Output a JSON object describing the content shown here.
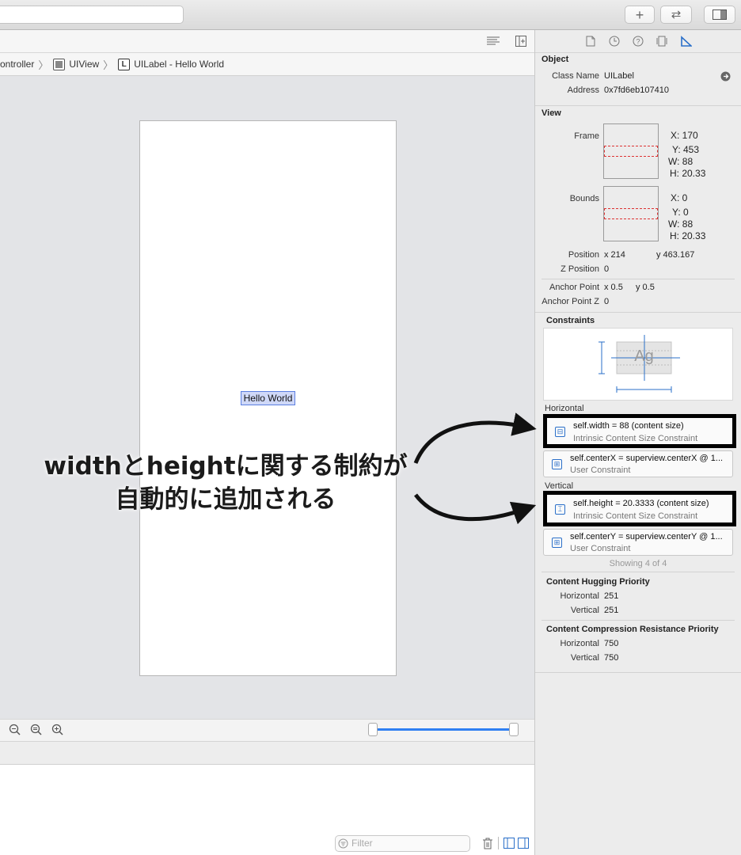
{
  "toolbar": {
    "add_icon": "plus-icon",
    "add_label": "+",
    "swap_icon": "swap-arrows-icon",
    "swap_label": "⇄",
    "panel_icon": "right-panel-toggle-icon"
  },
  "breadcrumb": {
    "items": [
      "ontroller",
      "UIView",
      "UILabel - Hello World"
    ],
    "label_glyph": "L"
  },
  "canvas": {
    "label_text": "Hello World"
  },
  "zoom": {
    "zoom_out_icon": "zoom-out-icon",
    "zoom_fit_icon": "zoom-fit-icon",
    "zoom_in_icon": "zoom-in-icon"
  },
  "console": {
    "filter_placeholder": "Filter"
  },
  "inspector": {
    "tabs": [
      "file-icon",
      "history-icon",
      "help-icon",
      "size-icon",
      "layout-icon"
    ],
    "object": {
      "title": "Object",
      "class_name_label": "Class Name",
      "class_name": "UILabel",
      "address_label": "Address",
      "address": "0x7fd6eb107410"
    },
    "view": {
      "title": "View",
      "frame_label": "Frame",
      "frame": {
        "x": "X: 170",
        "y": "Y: 453",
        "w": "W: 88",
        "h": "H: 20.33"
      },
      "bounds_label": "Bounds",
      "bounds": {
        "x": "X: 0",
        "y": "Y: 0",
        "w": "W: 88",
        "h": "H: 20.33"
      },
      "position_label": "Position",
      "position_x": "x 214",
      "position_y": "y 463.167",
      "zposition_label": "Z Position",
      "zposition": "0",
      "anchor_label": "Anchor Point",
      "anchor_x": "x 0.5",
      "anchor_y": "y 0.5",
      "anchor_z_label": "Anchor Point Z",
      "anchor_z": "0"
    },
    "constraints": {
      "title": "Constraints",
      "figure_text": "Ag",
      "horizontal_label": "Horizontal",
      "vertical_label": "Vertical",
      "horizontal": [
        {
          "text": "self.width = 88 (content size)",
          "kind": "Intrinsic Content Size Constraint"
        },
        {
          "text": "self.centerX = superview.centerX @ 1...",
          "kind": "User Constraint"
        }
      ],
      "vertical": [
        {
          "text": "self.height = 20.3333 (content size)",
          "kind": "Intrinsic Content Size Constraint"
        },
        {
          "text": "self.centerY = superview.centerY @ 1...",
          "kind": "User Constraint"
        }
      ],
      "showing": "Showing 4 of 4"
    },
    "hugging": {
      "title": "Content Hugging Priority",
      "horizontal_label": "Horizontal",
      "horizontal": "251",
      "vertical_label": "Vertical",
      "vertical": "251"
    },
    "compression": {
      "title": "Content Compression Resistance Priority",
      "horizontal_label": "Horizontal",
      "horizontal": "750",
      "vertical_label": "Vertical",
      "vertical": "750"
    }
  },
  "annotation": {
    "line1": "widthとheightに関する制約が",
    "line2": "自動的に追加される"
  }
}
